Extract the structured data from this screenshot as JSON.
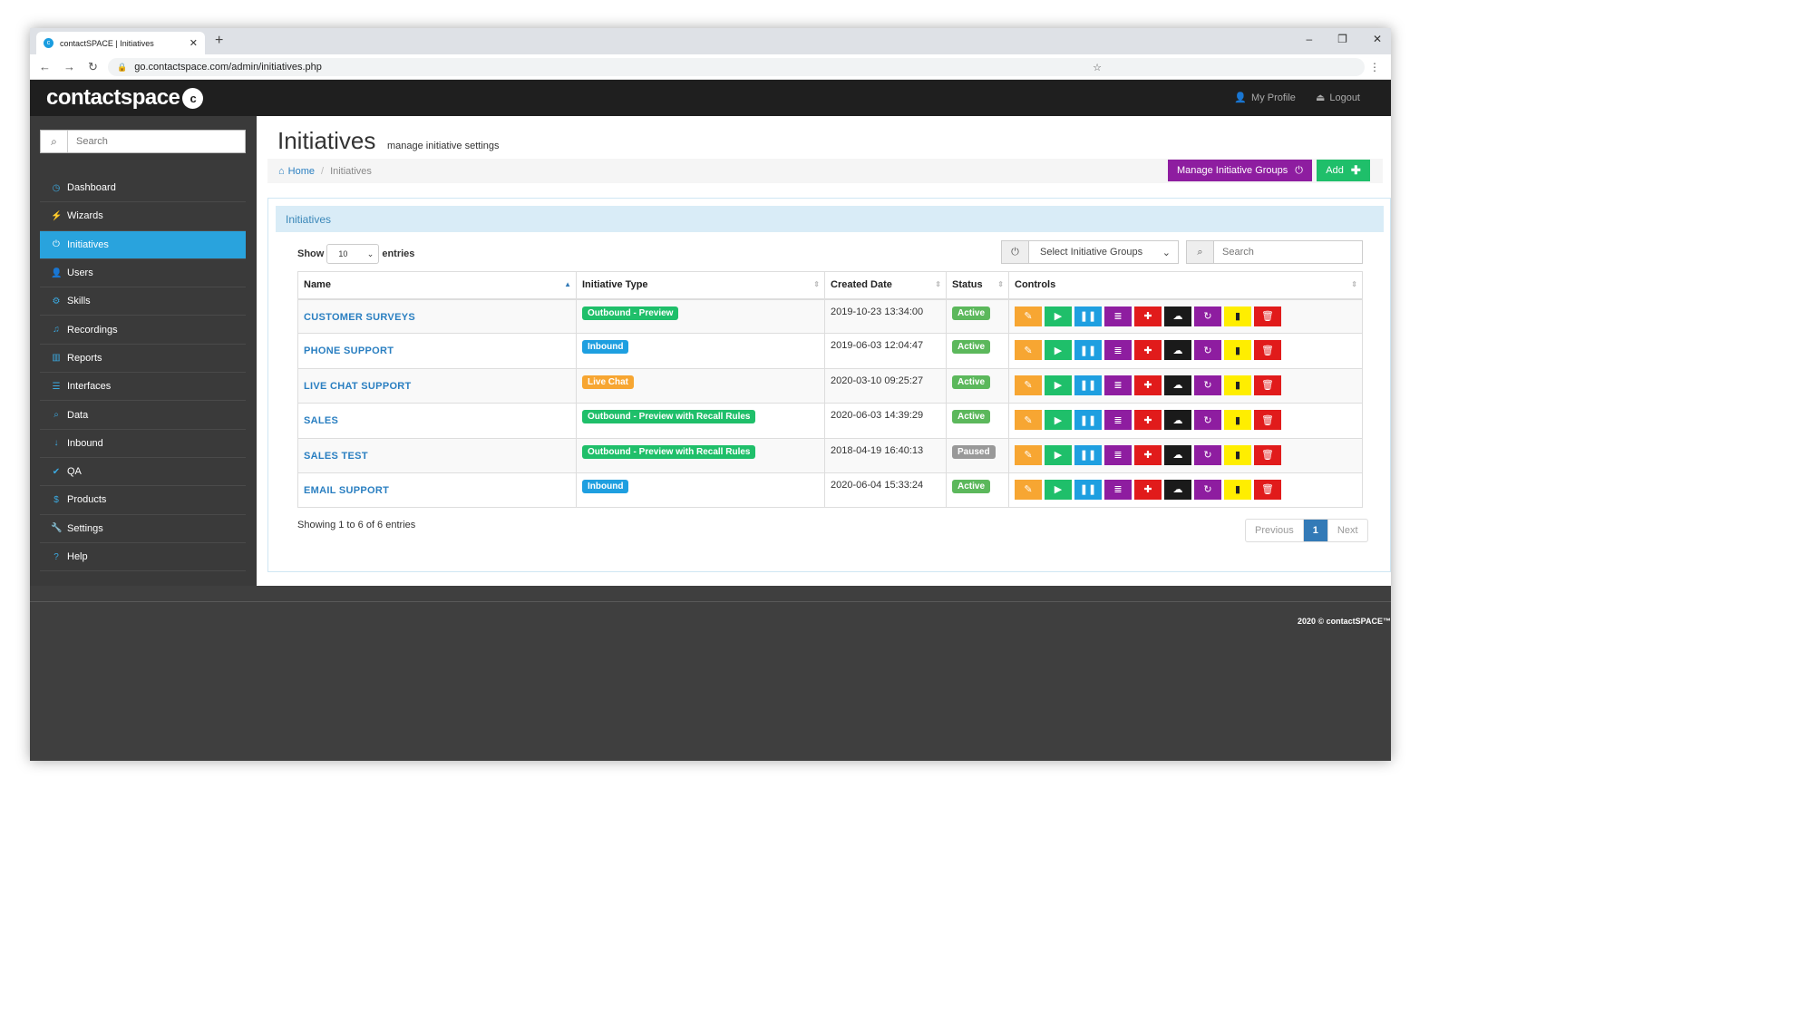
{
  "browser": {
    "tab_title": "contactSPACE | Initiatives",
    "url": "go.contactspace.com/admin/initiatives.php"
  },
  "header": {
    "logo": "contactspace",
    "links": [
      {
        "label": "My Profile",
        "icon": "user-icon"
      },
      {
        "label": "Logout",
        "icon": "logout-icon"
      }
    ]
  },
  "sidebar": {
    "search_placeholder": "Search",
    "items": [
      {
        "label": "Dashboard",
        "icon": "dashboard-icon",
        "active": false
      },
      {
        "label": "Wizards",
        "icon": "wizard-icon",
        "active": false
      },
      {
        "label": "Initiatives",
        "icon": "power-icon",
        "active": true
      },
      {
        "label": "Users",
        "icon": "user-icon",
        "active": false
      },
      {
        "label": "Skills",
        "icon": "skills-icon",
        "active": false
      },
      {
        "label": "Recordings",
        "icon": "music-icon",
        "active": false
      },
      {
        "label": "Reports",
        "icon": "bar-chart-icon",
        "active": false
      },
      {
        "label": "Interfaces",
        "icon": "list-icon",
        "active": false
      },
      {
        "label": "Data",
        "icon": "search-icon",
        "active": false
      },
      {
        "label": "Inbound",
        "icon": "arrow-down-icon",
        "active": false
      },
      {
        "label": "QA",
        "icon": "check-icon",
        "active": false
      },
      {
        "label": "Products",
        "icon": "dollar-icon",
        "active": false
      },
      {
        "label": "Settings",
        "icon": "wrench-icon",
        "active": false
      },
      {
        "label": "Help",
        "icon": "help-icon",
        "active": false
      }
    ]
  },
  "page": {
    "title": "Initiatives",
    "subtitle": "manage initiative settings",
    "breadcrumb_home": "Home",
    "breadcrumb_current": "Initiatives",
    "manage_groups_label": "Manage Initiative Groups",
    "add_label": "Add"
  },
  "panel": {
    "title": "Initiatives",
    "show_label": "Show",
    "entries_label": "entries",
    "entries_value": "10",
    "group_select_placeholder": "Select Initiative Groups",
    "search_placeholder": "Search",
    "showing_text": "Showing 1 to 6 of 6 entries",
    "pager": {
      "previous": "Previous",
      "current": "1",
      "next": "Next"
    }
  },
  "table": {
    "columns": [
      "Name",
      "Initiative Type",
      "Created Date",
      "Status",
      "Controls"
    ],
    "rows": [
      {
        "name": "CUSTOMER SURVEYS",
        "type": "Outbound - Preview",
        "type_color": "#1fbf6a",
        "created": "2019-10-23 13:34:00",
        "status": "Active",
        "status_color": "#5cb85c"
      },
      {
        "name": "PHONE SUPPORT",
        "type": "Inbound",
        "type_color": "#1e9fe0",
        "created": "2019-06-03 12:04:47",
        "status": "Active",
        "status_color": "#5cb85c"
      },
      {
        "name": "LIVE CHAT SUPPORT",
        "type": "Live Chat",
        "type_color": "#f7a632",
        "created": "2020-03-10 09:25:27",
        "status": "Active",
        "status_color": "#5cb85c"
      },
      {
        "name": "SALES",
        "type": "Outbound - Preview with Recall Rules",
        "type_color": "#1fbf6a",
        "created": "2020-06-03 14:39:29",
        "status": "Active",
        "status_color": "#5cb85c"
      },
      {
        "name": "SALES TEST",
        "type": "Outbound - Preview with Recall Rules",
        "type_color": "#1fbf6a",
        "created": "2018-04-19 16:40:13",
        "status": "Paused",
        "status_color": "#999999"
      },
      {
        "name": "EMAIL SUPPORT",
        "type": "Inbound",
        "type_color": "#1e9fe0",
        "created": "2020-06-04 15:33:24",
        "status": "Active",
        "status_color": "#5cb85c"
      }
    ],
    "control_buttons": [
      {
        "name": "edit-icon",
        "glyph": "✎",
        "color": "#f7a632"
      },
      {
        "name": "play-icon",
        "glyph": "▶",
        "color": "#1fbf6a"
      },
      {
        "name": "pause-icon",
        "glyph": "❚❚",
        "color": "#1e9fe0"
      },
      {
        "name": "list-icon",
        "glyph": "≣",
        "color": "#8e1da0"
      },
      {
        "name": "plus-icon",
        "glyph": "✚",
        "color": "#e11b1b"
      },
      {
        "name": "cloud-upload-icon",
        "glyph": "☁",
        "color": "#1a1a1a"
      },
      {
        "name": "refresh-icon",
        "glyph": "↻",
        "color": "#8e1da0"
      },
      {
        "name": "file-icon",
        "glyph": "▮",
        "color": "#ffee00"
      },
      {
        "name": "trash-icon",
        "glyph": "🗑",
        "color": "#e11b1b"
      }
    ]
  },
  "footer": {
    "copyright": "2020 © contactSPACE™"
  }
}
